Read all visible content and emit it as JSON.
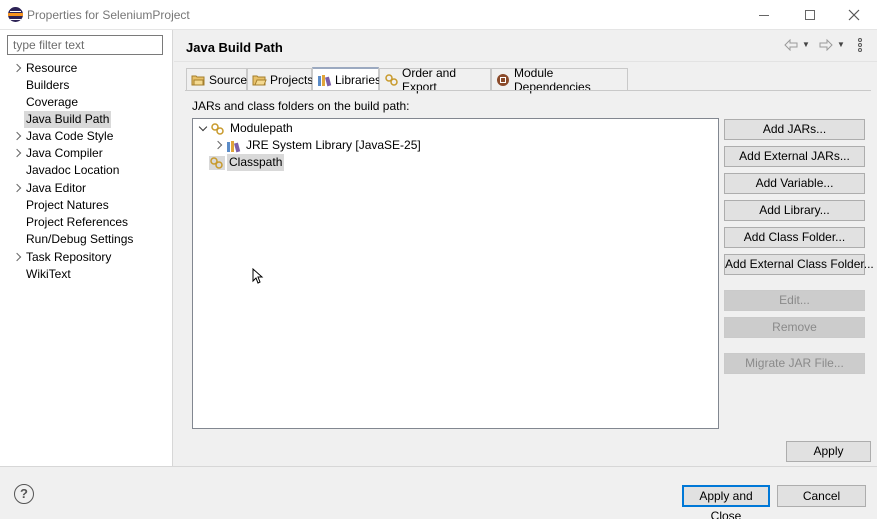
{
  "window": {
    "title": "Properties for SeleniumProject"
  },
  "filter": {
    "placeholder": "type filter text"
  },
  "nav_tree": [
    {
      "label": "Resource",
      "expandable": true
    },
    {
      "label": "Builders",
      "expandable": false
    },
    {
      "label": "Coverage",
      "expandable": false
    },
    {
      "label": "Java Build Path",
      "expandable": false,
      "selected": true
    },
    {
      "label": "Java Code Style",
      "expandable": true
    },
    {
      "label": "Java Compiler",
      "expandable": true
    },
    {
      "label": "Javadoc Location",
      "expandable": false
    },
    {
      "label": "Java Editor",
      "expandable": true
    },
    {
      "label": "Project Natures",
      "expandable": false
    },
    {
      "label": "Project References",
      "expandable": false
    },
    {
      "label": "Run/Debug Settings",
      "expandable": false
    },
    {
      "label": "Task Repository",
      "expandable": true
    },
    {
      "label": "WikiText",
      "expandable": false
    }
  ],
  "page": {
    "title": "Java Build Path"
  },
  "tabs": [
    {
      "label": "Source",
      "icon": "source-folder-icon"
    },
    {
      "label": "Projects",
      "icon": "projects-folder-icon"
    },
    {
      "label": "Libraries",
      "icon": "libraries-icon",
      "active": true
    },
    {
      "label": "Order and Export",
      "icon": "order-export-icon"
    },
    {
      "label": "Module Dependencies",
      "icon": "module-dependencies-icon"
    }
  ],
  "libraries": {
    "label": "JARs and class folders on the build path:",
    "entries": {
      "modulepath": "Modulepath",
      "jre": "JRE System Library [JavaSE-25]",
      "classpath": "Classpath"
    }
  },
  "buttons": {
    "add_jars": "Add JARs...",
    "add_external_jars": "Add External JARs...",
    "add_variable": "Add Variable...",
    "add_library": "Add Library...",
    "add_class_folder": "Add Class Folder...",
    "add_external_class_folder": "Add External Class Folder...",
    "edit": "Edit...",
    "remove": "Remove",
    "migrate_jar": "Migrate JAR File...",
    "apply": "Apply"
  },
  "footer": {
    "help": "?",
    "apply_and_close": "Apply and Close",
    "cancel": "Cancel"
  },
  "colors": {
    "selection": "#d9d9d9",
    "default_button_border": "#0078d7"
  }
}
